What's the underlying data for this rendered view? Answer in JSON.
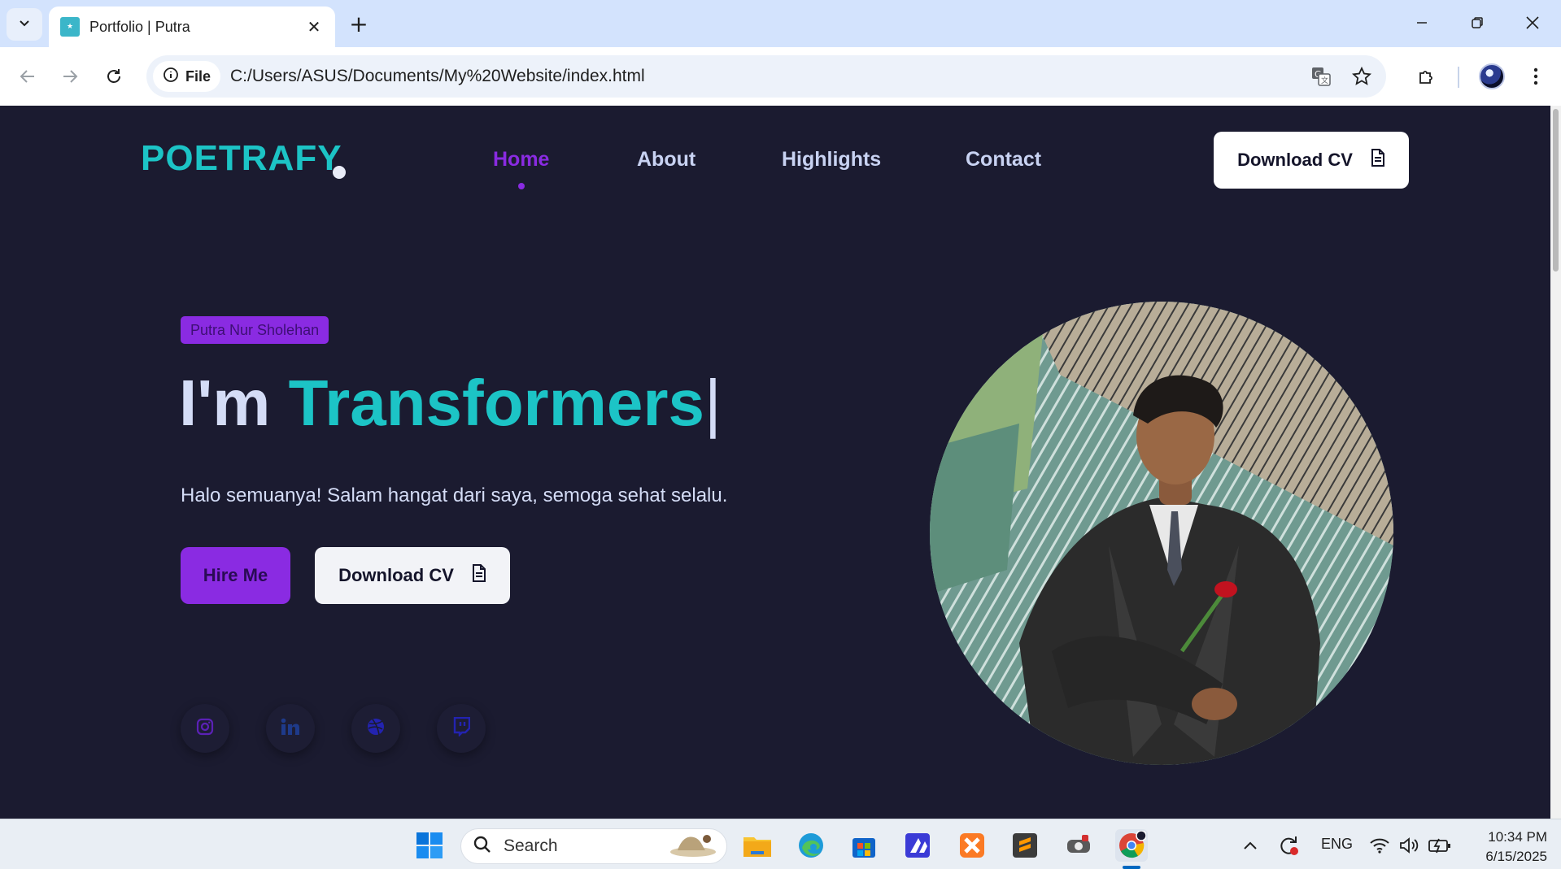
{
  "browser": {
    "tab_title": "Portfolio | Putra",
    "site_chip_label": "File",
    "url": "C:/Users/ASUS/Documents/My%20Website/index.html"
  },
  "site": {
    "logo": "POETRAFY",
    "nav": [
      "Home",
      "About",
      "Highlights",
      "Contact"
    ],
    "active_nav": "Home",
    "header_cv_label": "Download CV",
    "name_badge": "Putra Nur Sholehan",
    "headline_prefix": "I'm ",
    "headline_typed": "Transformers",
    "headline_cursor": "|",
    "greeting": "Halo semuanya! Salam hangat dari saya, semoga sehat selalu.",
    "hire_label": "Hire Me",
    "hero_cv_label": "Download CV",
    "socials": [
      "instagram-icon",
      "linkedin-icon",
      "dribbble-icon",
      "twitch-icon"
    ],
    "colors": {
      "accent": "#1cc4c6",
      "purple": "#8a2be2",
      "background": "#1b1b30"
    }
  },
  "taskbar": {
    "search_label": "Search",
    "language": "ENG",
    "time": "10:34 PM",
    "date": "6/15/2025"
  }
}
